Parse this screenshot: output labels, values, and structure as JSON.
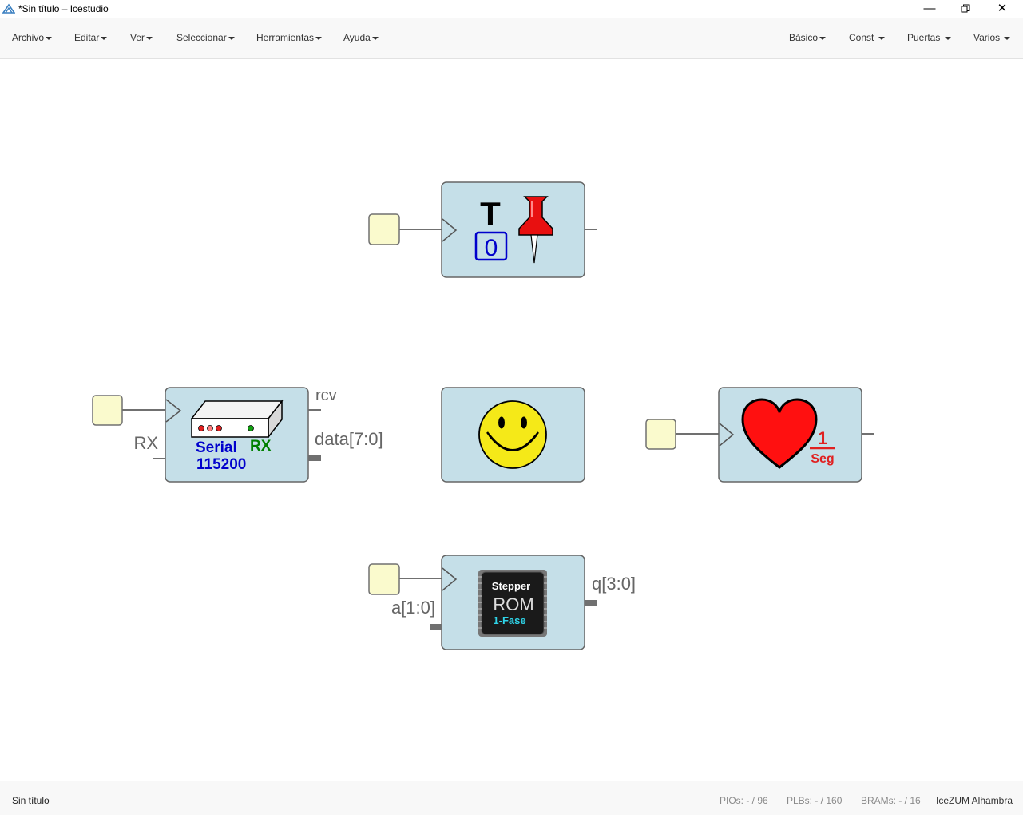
{
  "window": {
    "title": "*Sin título – Icestudio",
    "controls": [
      "minimize-icon",
      "restore-icon",
      "close-icon"
    ]
  },
  "menu": {
    "left": [
      "Archivo",
      "Editar",
      "Ver",
      "Seleccionar",
      "Herramientas",
      "Ayuda"
    ],
    "right": [
      "Básico",
      "Const",
      "Puertas",
      "Varios"
    ]
  },
  "blocks": {
    "toggle": {
      "letter": "T",
      "value": "0",
      "icon": "pushpin-icon"
    },
    "serial_rx": {
      "port_in": "RX",
      "port_rcv": "rcv",
      "port_data": "data[7:0]",
      "label_serial": "Serial",
      "label_rx": "RX",
      "baud": "115200",
      "icon": "modem-icon"
    },
    "smiley": {
      "icon": "smiley-icon"
    },
    "heartbeat": {
      "num": "1",
      "den": "Seg",
      "icon": "heart-icon"
    },
    "rom": {
      "port_in": "a[1:0]",
      "port_out": "q[3:0]",
      "title": "Stepper",
      "rom": "ROM",
      "mode": "1-Fase",
      "icon": "chip-icon"
    }
  },
  "status": {
    "file": "Sin título",
    "pios": "PIOs:  - / 96",
    "plbs": "PLBs:  - / 160",
    "brams": "BRAMs:  - / 16",
    "board": "IceZUM Alhambra"
  },
  "colors": {
    "block_fill": "#c5dfe8",
    "block_stroke": "#666666",
    "input_fill": "#fafacd",
    "wire": "#707070",
    "serial_blue": "#0000cc",
    "serial_green": "#008000",
    "heart_red": "#e02020",
    "rom_cyan": "#2fd4e8"
  }
}
